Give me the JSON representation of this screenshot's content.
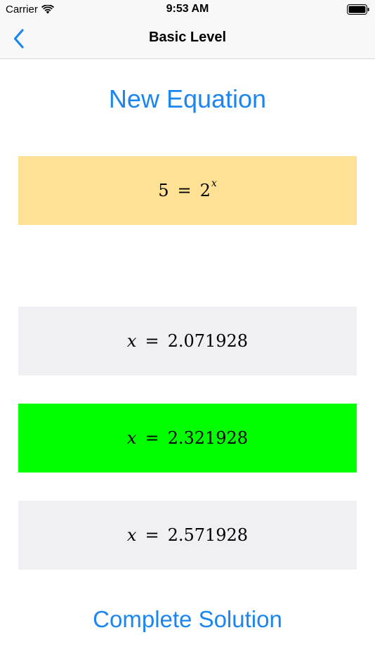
{
  "status_bar": {
    "carrier": "Carrier",
    "time": "9:53 AM"
  },
  "nav": {
    "title": "Basic Level",
    "back_icon": "chevron-left-icon"
  },
  "new_equation_label": "New Equation",
  "equation": {
    "lhs": "5",
    "equals": "=",
    "base": "2",
    "exponent": "x"
  },
  "answers": [
    {
      "variable": "x",
      "equals": "=",
      "value": "2.071928",
      "highlight": false
    },
    {
      "variable": "x",
      "equals": "=",
      "value": "2.321928",
      "highlight": true
    },
    {
      "variable": "x",
      "equals": "=",
      "value": "2.571928",
      "highlight": false
    }
  ],
  "complete_solution_label": "Complete Solution",
  "colors": {
    "accent": "#1b85f0",
    "equation_bg": "#ffe196",
    "answer_bg": "#efeff4",
    "correct_bg": "#00ff00"
  }
}
